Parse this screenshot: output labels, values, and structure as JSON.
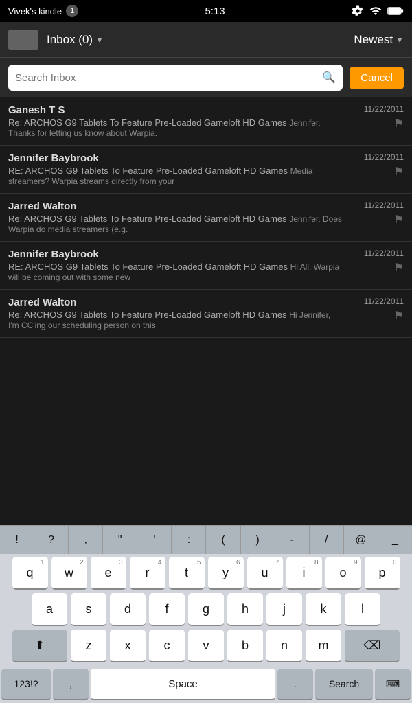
{
  "statusBar": {
    "title": "Vivek's kindle",
    "badge": "1",
    "time": "5:13"
  },
  "header": {
    "inbox": "Inbox (0)",
    "newest": "Newest"
  },
  "searchBar": {
    "placeholder": "Search Inbox",
    "cancelLabel": "Cancel"
  },
  "emails": [
    {
      "sender": "Ganesh T S",
      "subject": "Re: ARCHOS G9 Tablets To Feature Pre-Loaded Gameloft HD Games",
      "preview": "Jennifer, Thanks for letting us know about Warpia.",
      "date": "11/22/2011"
    },
    {
      "sender": "Jennifer Baybrook",
      "subject": "RE: ARCHOS G9 Tablets To Feature Pre-Loaded Gameloft HD Games",
      "preview": "Media streamers? Warpia streams directly from your",
      "date": "11/22/2011"
    },
    {
      "sender": "Jarred Walton",
      "subject": "Re: ARCHOS G9 Tablets To Feature Pre-Loaded Gameloft HD Games",
      "preview": "Jennifer, Does Warpia do media streamers (e.g.",
      "date": "11/22/2011"
    },
    {
      "sender": "Jennifer Baybrook",
      "subject": "RE: ARCHOS G9 Tablets To Feature Pre-Loaded Gameloft HD Games",
      "preview": "Hi All, Warpia will be coming out with some new",
      "date": "11/22/2011"
    },
    {
      "sender": "Jarred Walton",
      "subject": "Re: ARCHOS G9 Tablets To Feature Pre-Loaded Gameloft HD Games",
      "preview": "Hi Jennifer, I'm CC'ing our scheduling person on this",
      "date": "11/22/2011"
    }
  ],
  "keyboard": {
    "specialChars": [
      "!",
      "?",
      ",",
      "\"",
      "'",
      ":",
      "(",
      ")",
      "-",
      "/",
      "@",
      "_"
    ],
    "rows": [
      [
        {
          "label": "q",
          "num": "1"
        },
        {
          "label": "w",
          "num": "2"
        },
        {
          "label": "e",
          "num": "3"
        },
        {
          "label": "r",
          "num": "4"
        },
        {
          "label": "t",
          "num": "5"
        },
        {
          "label": "y",
          "num": "6"
        },
        {
          "label": "u",
          "num": "7"
        },
        {
          "label": "i",
          "num": "8"
        },
        {
          "label": "o",
          "num": "9"
        },
        {
          "label": "p",
          "num": "0"
        }
      ],
      [
        {
          "label": "a"
        },
        {
          "label": "s"
        },
        {
          "label": "d"
        },
        {
          "label": "f"
        },
        {
          "label": "g"
        },
        {
          "label": "h"
        },
        {
          "label": "j"
        },
        {
          "label": "k"
        },
        {
          "label": "l"
        }
      ],
      [
        {
          "label": "⬆",
          "wide": true,
          "dark": true
        },
        {
          "label": "z"
        },
        {
          "label": "x"
        },
        {
          "label": "c"
        },
        {
          "label": "v"
        },
        {
          "label": "b"
        },
        {
          "label": "n"
        },
        {
          "label": "m"
        },
        {
          "label": "⌫",
          "wide": true,
          "dark": true
        }
      ]
    ],
    "bottomRow": {
      "num": "123!?",
      "comma": ",",
      "space": "Space",
      "period": ".",
      "search": "Search",
      "emoji": "⌨"
    }
  }
}
